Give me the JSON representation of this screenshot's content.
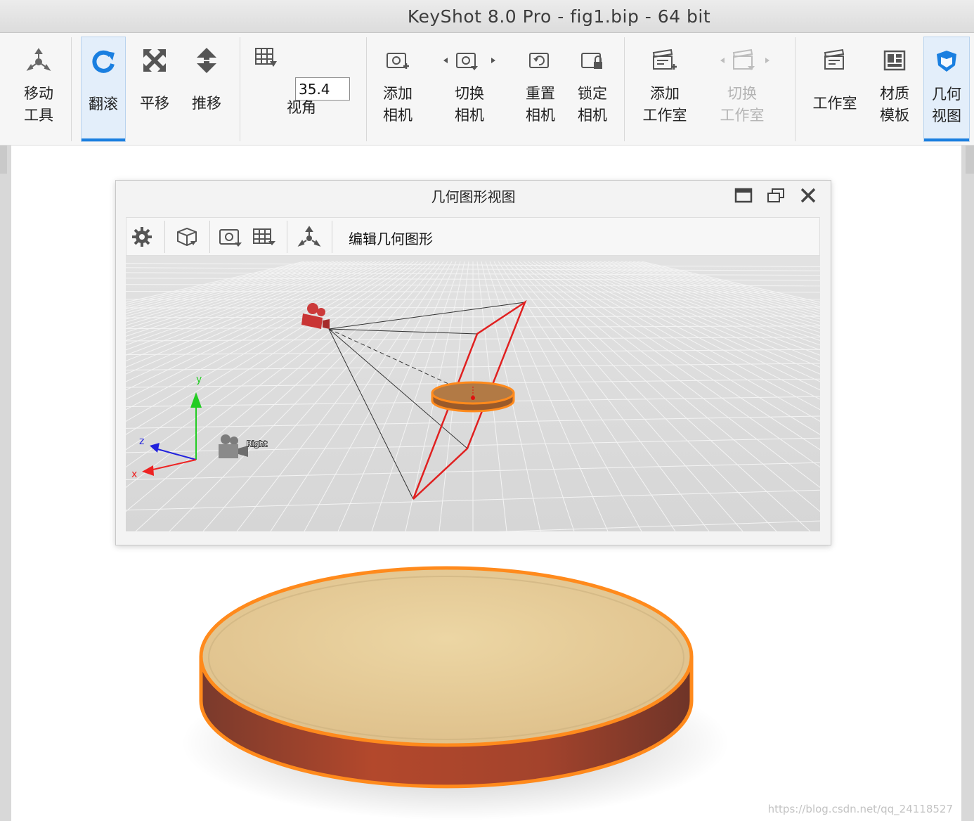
{
  "window": {
    "title": "KeyShot 8.0 Pro  - fig1.bip  - 64 bit"
  },
  "toolbar": {
    "move_tool": "移动\n工具",
    "tumble": "翻滚",
    "pan": "平移",
    "dolly": "推移",
    "fov_label": "视角",
    "fov_value": "35.4",
    "add_camera": "添加\n相机",
    "switch_camera": "切换\n相机",
    "reset_camera": "重置\n相机",
    "lock_camera": "锁定\n相机",
    "add_studio": "添加\n工作室",
    "switch_studio": "切换\n工作室",
    "studio": "工作室",
    "material_template": "材质\n模板",
    "geometry_view": "几何\n视图"
  },
  "geometry_window": {
    "title": "几何图形视图",
    "edit_label": "编辑几何图形",
    "axis_x": "x",
    "axis_y": "y",
    "axis_z": "z",
    "camera_label": "Right"
  },
  "watermark": "https://blog.csdn.net/qq_24118527",
  "colors": {
    "accent": "#1a7fe0",
    "selection": "#ff8c1a",
    "frustum": "#e02020",
    "disc_top": "#e8cf9a",
    "disc_side": "#b0452a"
  }
}
